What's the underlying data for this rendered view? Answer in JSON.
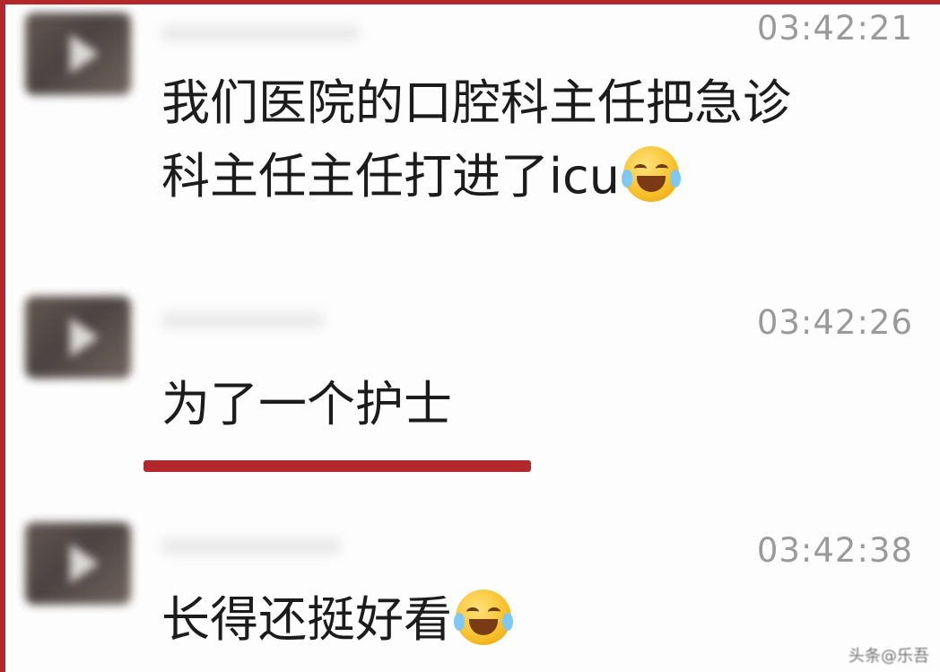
{
  "messages": [
    {
      "time": "03:42:21",
      "lines": [
        "我们医院的口腔科主任把急诊",
        "科主任主任打进了icu"
      ],
      "emoji": "face-with-tears-of-joy-icon"
    },
    {
      "time": "03:42:26",
      "lines": [
        "为了一个护士"
      ]
    },
    {
      "time": "03:42:38",
      "lines": [
        "长得还挺好看"
      ],
      "emoji": "face-with-tears-of-joy-icon"
    }
  ],
  "watermark": "头条@乐吾",
  "colors": {
    "frame": "#b3282d",
    "underline": "#b3282d",
    "timestamp": "#9a9a9c",
    "text": "#1c1c1c"
  }
}
